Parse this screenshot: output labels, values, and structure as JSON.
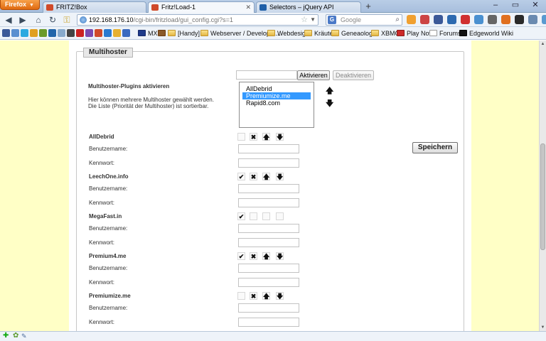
{
  "browser": {
    "menu_button": "Firefox",
    "tabs": [
      {
        "label": "FRITZ!Box",
        "fav_color": "#d04a2a"
      },
      {
        "label": "Fritz!Load-1",
        "fav_color": "#d04a2a"
      },
      {
        "label": "Selectors – jQuery API",
        "fav_color": "#1f5fa8"
      }
    ],
    "new_tab": "+",
    "address_host": "192.168.176.10",
    "address_path": "/cgi-bin/fritzload/gui_config.cgi?s=1",
    "search_engine": "G",
    "search_placeholder": "Google",
    "bookmarks": [
      {
        "label": "MX",
        "folder": false
      },
      {
        "label": "[Handy]",
        "folder": true
      },
      {
        "label": "Webserver / Developm...",
        "folder": true
      },
      {
        "label": "Webdesign",
        "folder": true
      },
      {
        "label": "Kräuter",
        "folder": true
      },
      {
        "label": "Geneaologie",
        "folder": true
      },
      {
        "label": "XBMC",
        "folder": true
      },
      {
        "label": "Play Now",
        "folder": false
      },
      {
        "label": "Forums",
        "folder": false
      },
      {
        "label": "Edgeworld Wiki",
        "folder": false
      }
    ]
  },
  "section": {
    "legend": "Multihoster",
    "plugins_label": "Multihoster-Plugins aktivieren",
    "help_line1": "Hier können mehrere Multihoster gewählt werden.",
    "help_line2": "Die Liste (Priorität der Multihoster) ist sortierbar.",
    "activate_button": "Aktivieren",
    "deactivate_button": "Deaktivieren",
    "list_options": [
      "AllDebrid",
      "Premiumize.me",
      "Rapid8.com"
    ],
    "selected_option": "Premiumize.me",
    "save_button": "Speichern"
  },
  "hosters": [
    {
      "name": "AllDebrid",
      "user_label": "Benutzername:",
      "pass_label": "Kennwort:",
      "user_value": "",
      "pass_value": "",
      "icons": [
        "empty-checkbox",
        "cross",
        "arrow-up",
        "arrow-down"
      ]
    },
    {
      "name": "LeechOne.info",
      "user_label": "Benutzername:",
      "pass_label": "Kennwort:",
      "user_value": "",
      "pass_value": "",
      "icons": [
        "check",
        "cross",
        "arrow-up",
        "arrow-down"
      ]
    },
    {
      "name": "MegaFast.in",
      "user_label": "Benutzername:",
      "pass_label": "Kennwort:",
      "user_value": "",
      "pass_value": "",
      "icons": [
        "check",
        "empty",
        "empty",
        "empty"
      ]
    },
    {
      "name": "Premium4.me",
      "user_label": "Benutzername:",
      "pass_label": "Kennwort:",
      "user_value": "",
      "pass_value": "",
      "icons": [
        "check",
        "cross",
        "arrow-up",
        "arrow-down"
      ]
    },
    {
      "name": "Premiumize.me",
      "user_label": "Benutzername:",
      "pass_label": "Kennwort:",
      "user_value": "",
      "pass_value": "",
      "icons": [
        "empty-checkbox",
        "cross",
        "arrow-up",
        "arrow-down"
      ]
    }
  ],
  "glyphs": {
    "check": "✔",
    "cross": "✖",
    "arrow-up": "🡅",
    "arrow-down": "🡇",
    "empty": "",
    "empty-checkbox": ""
  },
  "colors": {
    "page_bg": "#ffffc6",
    "selection": "#3399ff",
    "firefox_orange": "#e06a10"
  }
}
